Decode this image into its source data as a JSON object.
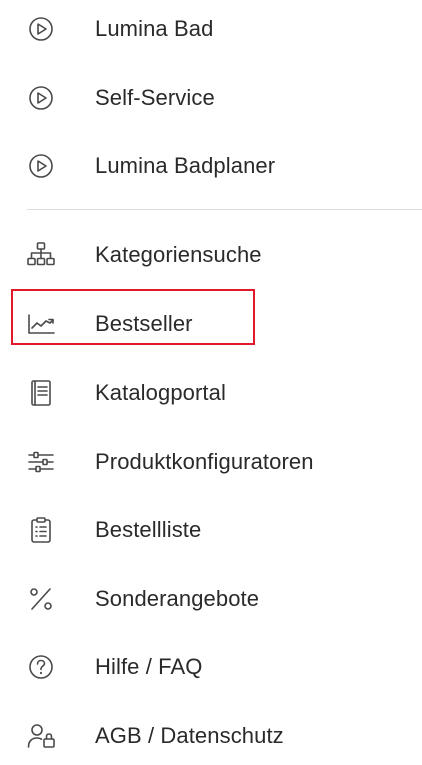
{
  "menu": {
    "items": [
      {
        "label": "Lumina Bad",
        "icon": "play-circle-icon"
      },
      {
        "label": "Self-Service",
        "icon": "play-circle-icon"
      },
      {
        "label": "Lumina Badplaner",
        "icon": "play-circle-icon"
      },
      {
        "label": "Kategoriensuche",
        "icon": "sitemap-icon"
      },
      {
        "label": "Bestseller",
        "icon": "trending-chart-icon",
        "highlighted": true
      },
      {
        "label": "Katalogportal",
        "icon": "catalog-book-icon"
      },
      {
        "label": "Produktkonfiguratoren",
        "icon": "sliders-icon"
      },
      {
        "label": "Bestellliste",
        "icon": "clipboard-list-icon"
      },
      {
        "label": "Sonderangebote",
        "icon": "percent-icon"
      },
      {
        "label": "Hilfe / FAQ",
        "icon": "help-circle-icon"
      },
      {
        "label": "AGB / Datenschutz",
        "icon": "user-lock-icon"
      }
    ]
  },
  "colors": {
    "text": "#2a2a2a",
    "icon": "#4a4a4a",
    "divider": "#dcdcdc",
    "highlight": "#e0192b"
  }
}
